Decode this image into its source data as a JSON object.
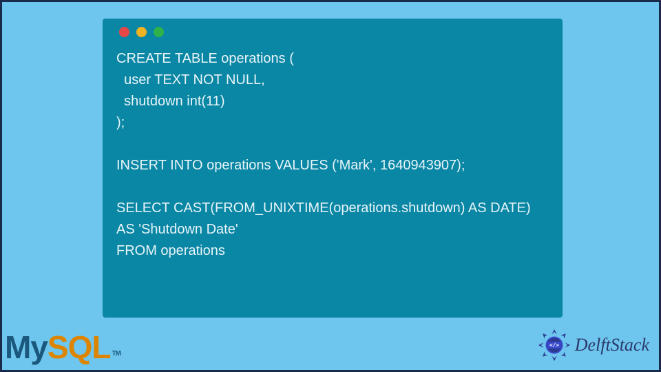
{
  "code_window": {
    "traffic_lights": [
      "red",
      "yellow",
      "green"
    ],
    "code": "CREATE TABLE operations (\n  user TEXT NOT NULL,\n  shutdown int(11)\n);\n\nINSERT INTO operations VALUES ('Mark', 1640943907);\n\nSELECT CAST(FROM_UNIXTIME(operations.shutdown) AS DATE)\nAS 'Shutdown Date'\nFROM operations"
  },
  "logos": {
    "mysql": {
      "my": "My",
      "sql": "SQL",
      "tm": "TM"
    },
    "delftstack": {
      "text": "DelftStack",
      "badge_glyph": "</>"
    }
  },
  "colors": {
    "page_bg": "#6ec5ed",
    "window_bg": "#0a87a5",
    "code_text": "#e8f4f8"
  }
}
